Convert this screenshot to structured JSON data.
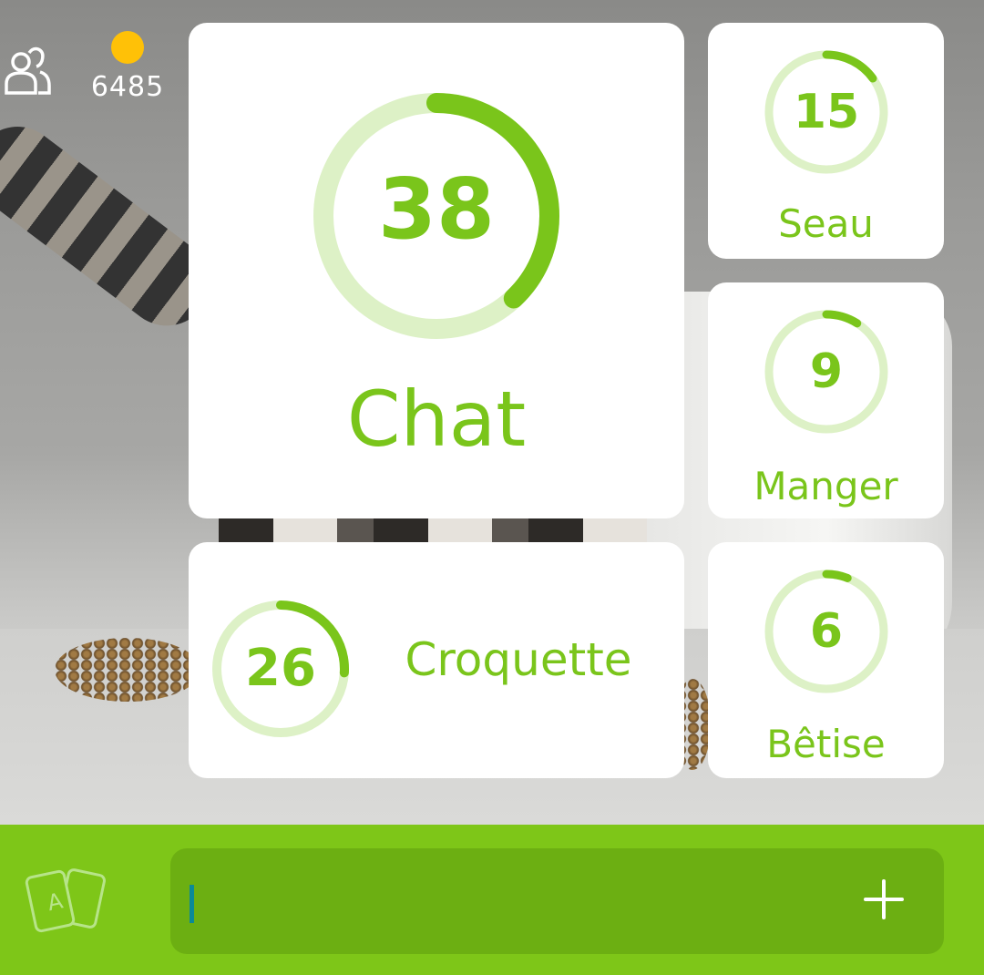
{
  "hud": {
    "coins": "6485",
    "coin_color": "#ffc107",
    "friends_icon": "friends-icon"
  },
  "game": {
    "accent_color": "#7ac51b",
    "track_color": "#ddf1c6",
    "answers": [
      {
        "word": "Chat",
        "percent": 38,
        "found": true
      },
      {
        "word": "Seau",
        "percent": 15,
        "found": true
      },
      {
        "word": "Manger",
        "percent": 9,
        "found": true
      },
      {
        "word": "Croquette",
        "percent": 26,
        "found": true
      },
      {
        "word": "Bêtise",
        "percent": 6,
        "found": true
      }
    ]
  },
  "input": {
    "value": "",
    "deck_icon": "cards-icon",
    "submit_icon": "plus-icon"
  }
}
